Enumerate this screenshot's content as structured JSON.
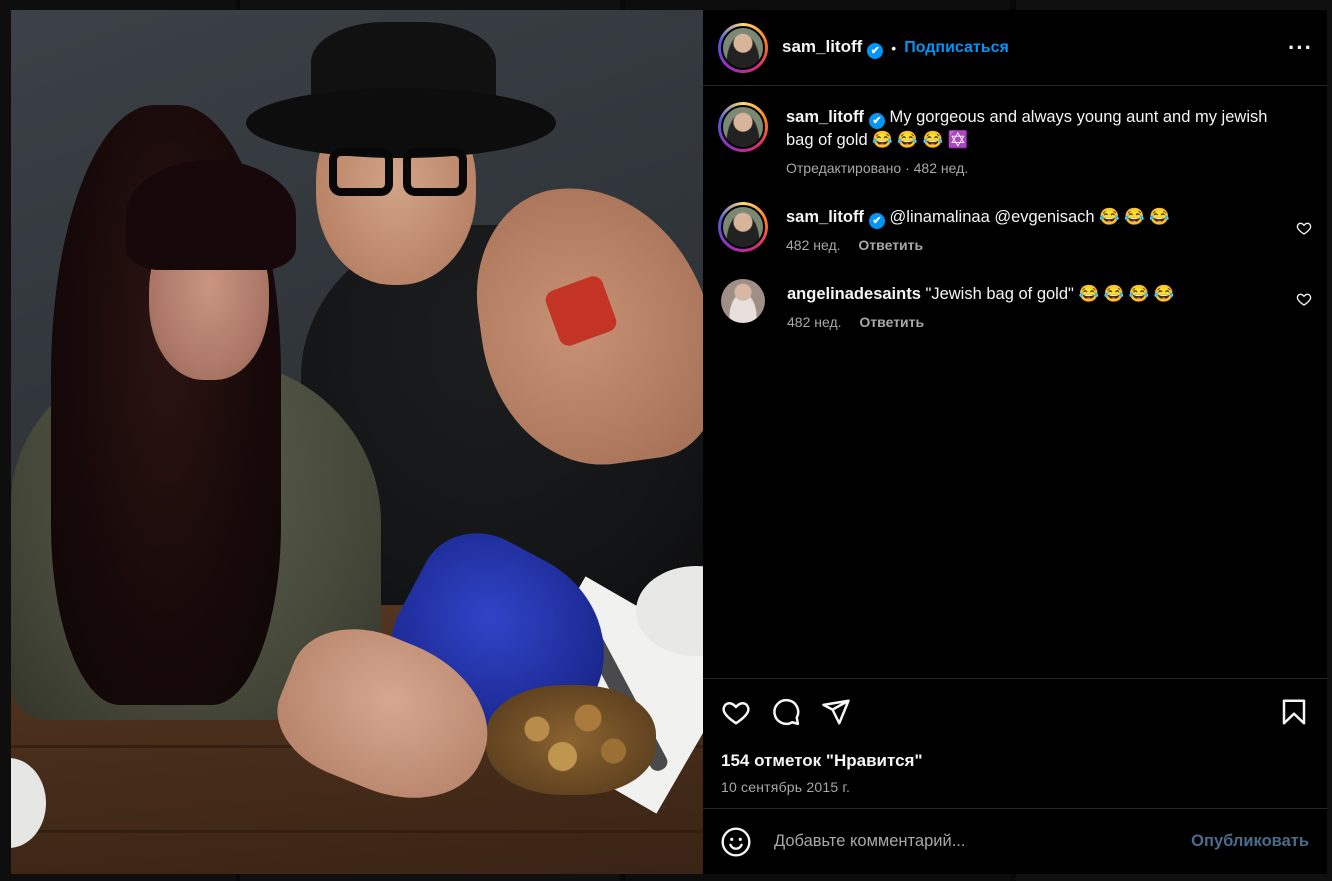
{
  "header": {
    "username": "sam_litoff",
    "verified_mark": "✔",
    "separator": "•",
    "follow_label": "Подписаться",
    "more_label": "···"
  },
  "comments": [
    {
      "username": "sam_litoff",
      "text": "My gorgeous and always young aunt and my jewish bag of gold 😂 😂 😂 ✡️",
      "meta": "Отредактировано · 482 нед.",
      "verified": true,
      "is_caption": true
    },
    {
      "username": "sam_litoff",
      "text": "@linamalinaa @evgenisach 😂 😂 😂",
      "time": "482 нед.",
      "reply_label": "Ответить",
      "verified": true
    },
    {
      "username": "angelinadesaints",
      "text": "\"Jewish bag of gold\" 😂 😂 😂 😂",
      "time": "482 нед.",
      "reply_label": "Ответить",
      "verified": false
    }
  ],
  "actions": {
    "icons": [
      "heart-icon",
      "comment-icon",
      "share-icon",
      "bookmark-icon"
    ],
    "likes_text": "154 отметок \"Нравится\"",
    "date_text": "10 сентябрь 2015 г."
  },
  "add_comment": {
    "placeholder": "Добавьте комментарий...",
    "post_label": "Опубликовать"
  },
  "colors": {
    "accent": "#0095f6",
    "post_disabled": "#4b6c8a",
    "muted": "#a8a8a8",
    "background": "#000000"
  }
}
